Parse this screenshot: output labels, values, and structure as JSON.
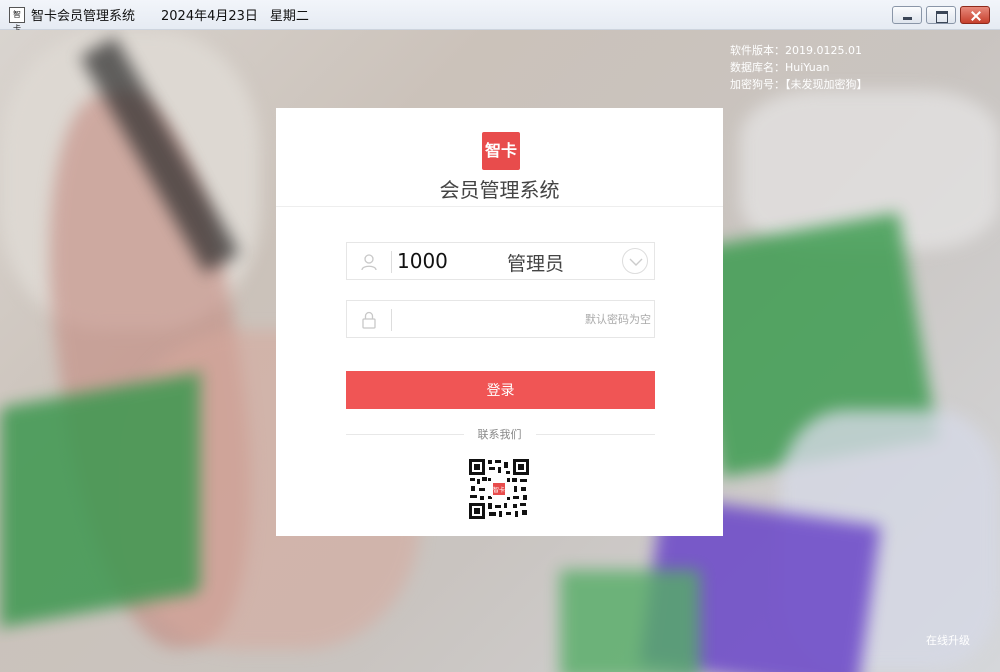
{
  "window": {
    "icon_label": "智卡",
    "title": "智卡会员管理系统",
    "date": "2024年4月23日",
    "weekday": "星期二",
    "buttons": [
      "minimize",
      "maximize",
      "close"
    ]
  },
  "sysinfo": {
    "version": "软件版本：2019.0125.01",
    "database": "数据库名：HuiYuan",
    "dongle": "加密狗号：【未发现加密狗】"
  },
  "card": {
    "logo_text": "智卡",
    "title": "会员管理系统",
    "user_id": "1000",
    "user_role": "管理员",
    "password_value": "",
    "password_placeholder": "默认密码为空",
    "login_label": "登录",
    "contact_label": "联系我们",
    "qr_center_label": "智卡"
  },
  "footer": {
    "upgrade_label": "在线升级"
  },
  "colors": {
    "accent": "#f05555",
    "logo": "#e84c4c"
  },
  "icons": {
    "user": "user-icon",
    "lock": "lock-icon",
    "dropdown": "chevron-down-icon",
    "qr": "qr-code-icon"
  }
}
